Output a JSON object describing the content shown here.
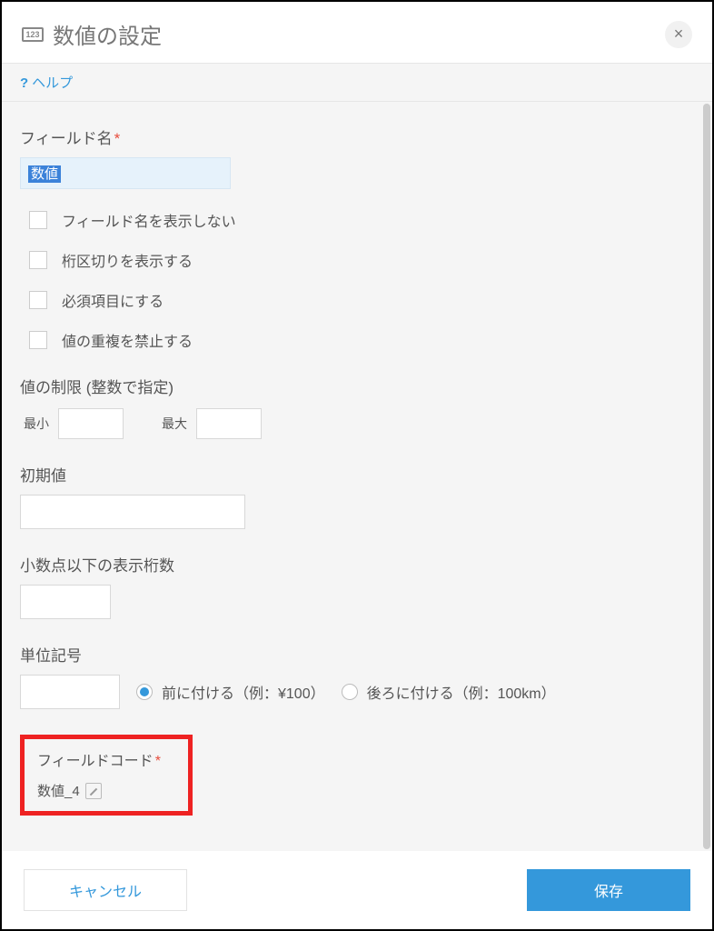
{
  "header": {
    "icon_text": "123",
    "title": "数値の設定",
    "help_label": "ヘルプ"
  },
  "field_name": {
    "label": "フィールド名",
    "value": "数値"
  },
  "checkboxes": {
    "hide_name": "フィールド名を表示しない",
    "digit_group": "桁区切りを表示する",
    "required": "必須項目にする",
    "unique": "値の重複を禁止する"
  },
  "range": {
    "label": "値の制限 (整数で指定)",
    "min_label": "最小",
    "min_value": "",
    "max_label": "最大",
    "max_value": ""
  },
  "default": {
    "label": "初期値",
    "value": ""
  },
  "decimal": {
    "label": "小数点以下の表示桁数",
    "value": ""
  },
  "unit": {
    "label": "単位記号",
    "value": "",
    "before_label": "前に付ける（例：¥100）",
    "after_label": "後ろに付ける（例：100km）",
    "selected": "before"
  },
  "field_code": {
    "label": "フィールドコード",
    "value": "数値_4"
  },
  "footer": {
    "cancel": "キャンセル",
    "save": "保存"
  }
}
